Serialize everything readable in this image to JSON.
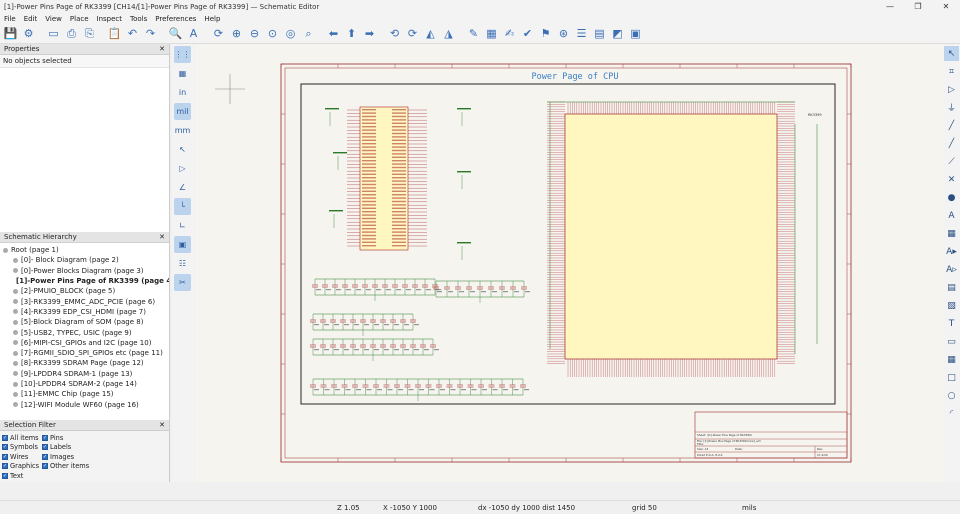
{
  "window": {
    "title": "[1]-Power Pins Page of RK3399 [CH14/[1]-Power Pins Page of RK3399] — Schematic Editor",
    "minimize": "—",
    "maximize": "❐",
    "close": "✕"
  },
  "menu": [
    "File",
    "Edit",
    "View",
    "Place",
    "Inspect",
    "Tools",
    "Preferences",
    "Help"
  ],
  "panels": {
    "properties": {
      "title": "Properties",
      "empty": "No objects selected"
    },
    "hierarchy": {
      "title": "Schematic Hierarchy",
      "items": [
        "Root (page 1)",
        "[0]- Block Diagram (page 2)",
        "[0]-Power Blocks Diagram (page 3)",
        "[1]-Power Pins Page of RK3399 (page 4)",
        "[2]-PMUIO_BLOCK (page 5)",
        "[3]-RK3399_EMMC_ADC_PCIE (page 6)",
        "[4]-RK3399 EDP_CSI_HDMI (page 7)",
        "[5]-Block Diagram of SOM (page 8)",
        "[5]-USB2, TYPEC, USIC (page 9)",
        "[6]-MIPI-CSI_GPIOs and I2C (page 10)",
        "[7]-RGMII_SDIO_SPI_GPIOs etc (page 11)",
        "[8]-RK3399 SDRAM Page (page 12)",
        "[9]-LPDDR4 SDRAM-1 (page 13)",
        "[10]-LPDDR4 SDRAM-2 (page 14)",
        "[11]-EMMC Chip (page 15)",
        "[12]-WIFI Module WF60 (page 16)"
      ]
    },
    "filter": {
      "title": "Selection Filter",
      "items": [
        "All items",
        "Pins",
        "Symbols",
        "Labels",
        "Wires",
        "Images",
        "Graphics",
        "Other items",
        "Text"
      ]
    }
  },
  "lefttools": {
    "units": [
      "in",
      "mil",
      "mm"
    ]
  },
  "sheet": {
    "title": "Power Page of CPU",
    "u1": "RK3399",
    "tb_sheet": "Sheet: /[1]-Power Pins Page of RK3399/",
    "tb_file": "File: [1]-Power Pins Page of RK3399.kicad_sch",
    "tb_title": "Title:",
    "tb_size": "Size: A3",
    "tb_date": "Date:",
    "tb_rev": "Rev:",
    "tb_kicad": "KiCad E.D.A. 8.0.0",
    "tb_id": "Id: 4/29"
  },
  "status": {
    "zoom": "Z 1.05",
    "xy": "X -1050  Y 1000",
    "dxy": "dx -1050  dy 1000  dist 1450",
    "grid": "grid 50",
    "units": "mils"
  }
}
